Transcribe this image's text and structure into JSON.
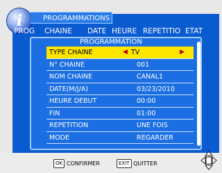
{
  "window": {
    "title": "PROGRAMMATIONS"
  },
  "tabs": [
    "PROG",
    "CHAINE",
    "DATE",
    "HEURE",
    "REPETITIO",
    "ETAT"
  ],
  "panel": {
    "title": "PROGRAMMATION",
    "rows": [
      {
        "label": "TYPE CHAINE",
        "value": "TV"
      },
      {
        "label": "N° CHAINE",
        "value": "001"
      },
      {
        "label": "NOM CHAINE",
        "value": "CANAL1"
      },
      {
        "label": "DATE(M/J/A)",
        "value": "03/23/2010"
      },
      {
        "label": "HEURE DEBUT",
        "value": "00:00"
      },
      {
        "label": "FIN",
        "value": "01:00"
      },
      {
        "label": "REPETITION",
        "value": "UNE FOIS"
      },
      {
        "label": "MODE",
        "value": "REGARDER"
      }
    ]
  },
  "footer": {
    "ok_key": "OK",
    "ok_label": "CONFIRMER",
    "exit_key": "EXIT",
    "exit_label": "QUITTER"
  },
  "colors": {
    "screen": "#0a5ad0",
    "panel": "#1c6fe2",
    "selected_row": "#ffe600",
    "arrows": "#b00000"
  }
}
